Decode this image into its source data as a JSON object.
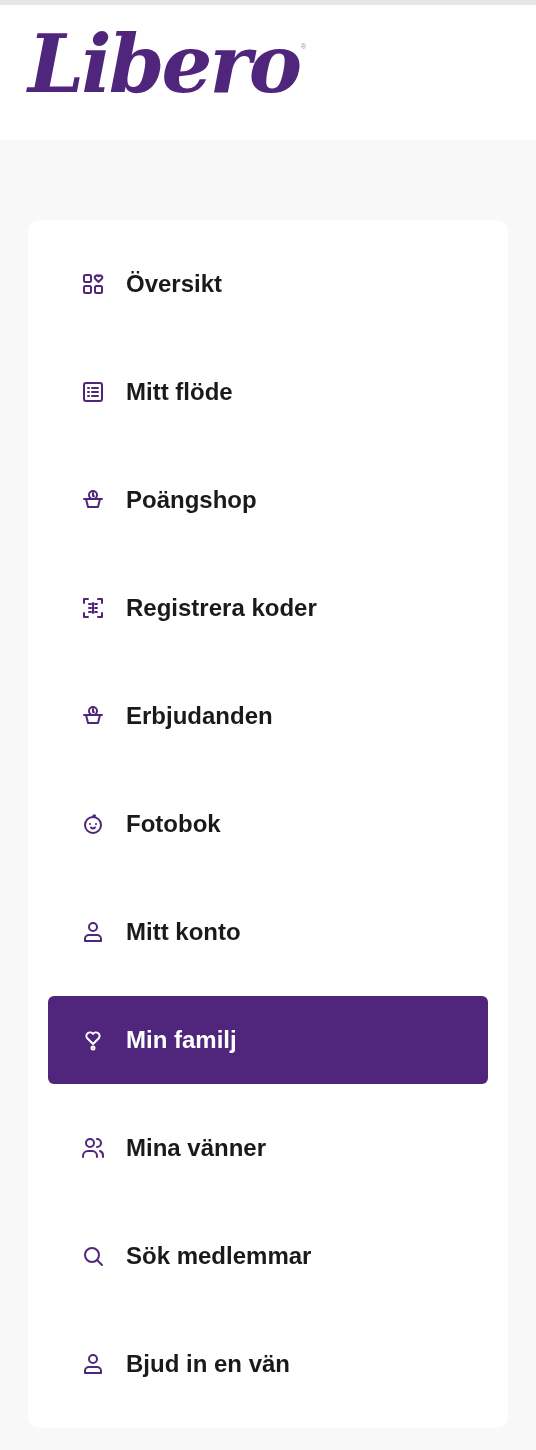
{
  "logo": {
    "text": "Libero",
    "mark": "®"
  },
  "menu": [
    {
      "label": "Översikt",
      "selected": false
    },
    {
      "label": "Mitt flöde",
      "selected": false
    },
    {
      "label": "Poängshop",
      "selected": false
    },
    {
      "label": "Registrera koder",
      "selected": false
    },
    {
      "label": "Erbjudanden",
      "selected": false
    },
    {
      "label": "Fotobok",
      "selected": false
    },
    {
      "label": "Mitt konto",
      "selected": false
    },
    {
      "label": "Min familj",
      "selected": true
    },
    {
      "label": "Mina vänner",
      "selected": false
    },
    {
      "label": "Sök medlemmar",
      "selected": false
    },
    {
      "label": "Bjud in en vän",
      "selected": false
    }
  ]
}
